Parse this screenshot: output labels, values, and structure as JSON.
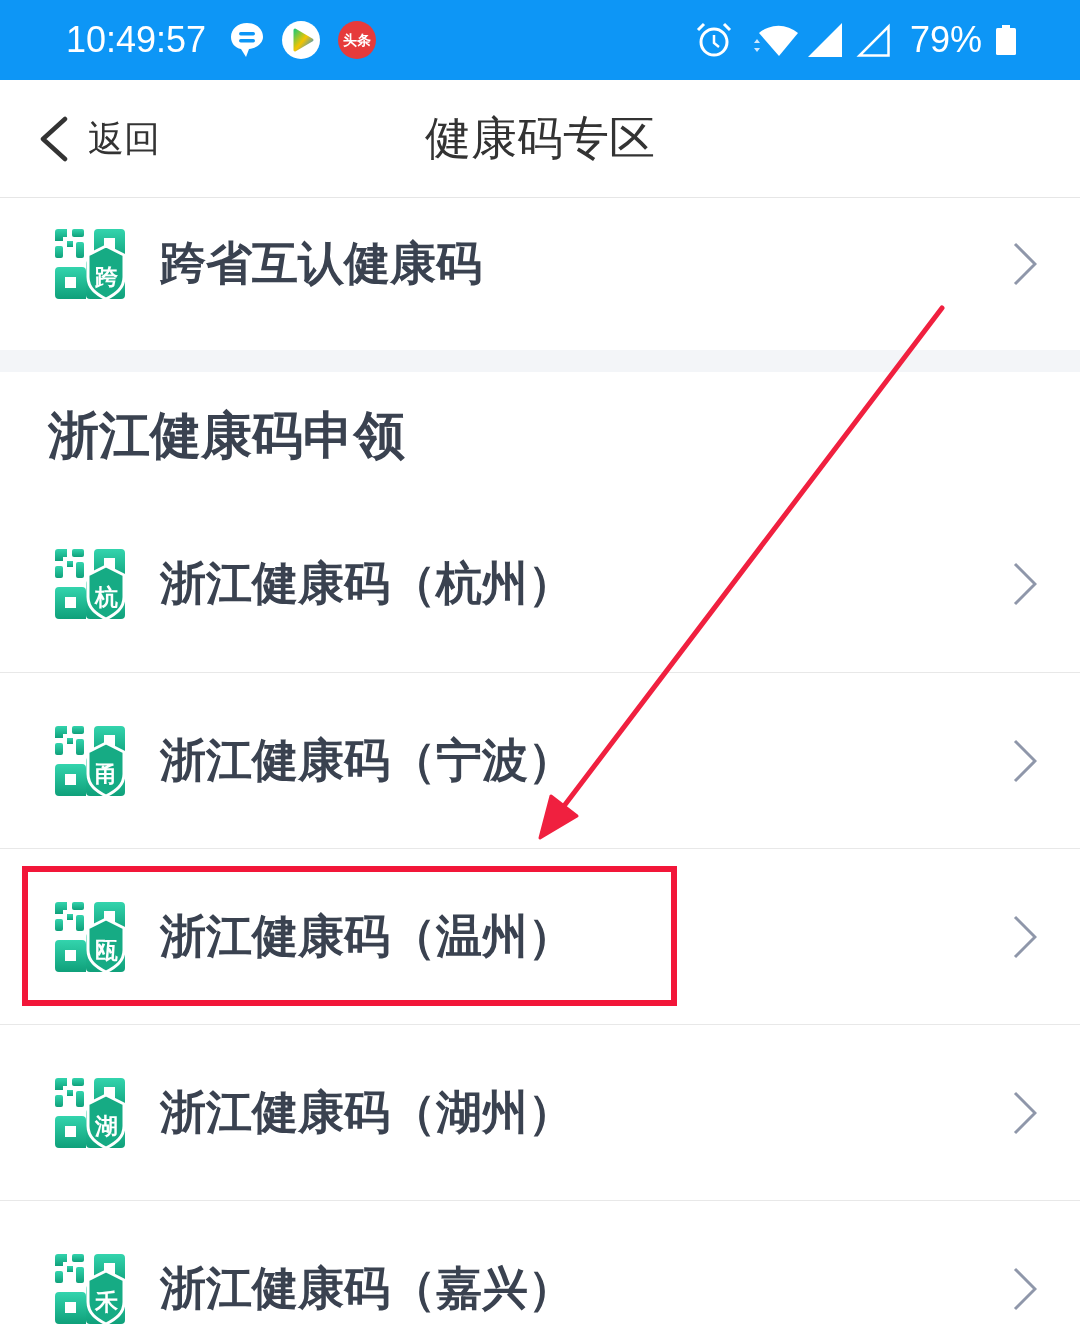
{
  "status_bar": {
    "time": "10:49:57",
    "notifications": [
      {
        "kind": "chat"
      },
      {
        "kind": "video"
      },
      {
        "kind": "news",
        "label": "头条"
      }
    ],
    "battery_text": "79%"
  },
  "nav_bar": {
    "back_label": "返回",
    "title": "健康码专区"
  },
  "top_items": [
    {
      "label": "跨省互认健康码",
      "badge": "跨",
      "highlighted": false
    }
  ],
  "section": {
    "title": "浙江健康码申领",
    "items": [
      {
        "label": "浙江健康码（杭州）",
        "badge": "杭",
        "highlighted": false
      },
      {
        "label": "浙江健康码（宁波）",
        "badge": "甬",
        "highlighted": false
      },
      {
        "label": "浙江健康码（温州）",
        "badge": "瓯",
        "highlighted": true
      },
      {
        "label": "浙江健康码（湖州）",
        "badge": "湖",
        "highlighted": false
      },
      {
        "label": "浙江健康码（嘉兴）",
        "badge": "禾",
        "highlighted": false
      }
    ]
  },
  "annotations": [
    {
      "kind": "arrow"
    }
  ]
}
